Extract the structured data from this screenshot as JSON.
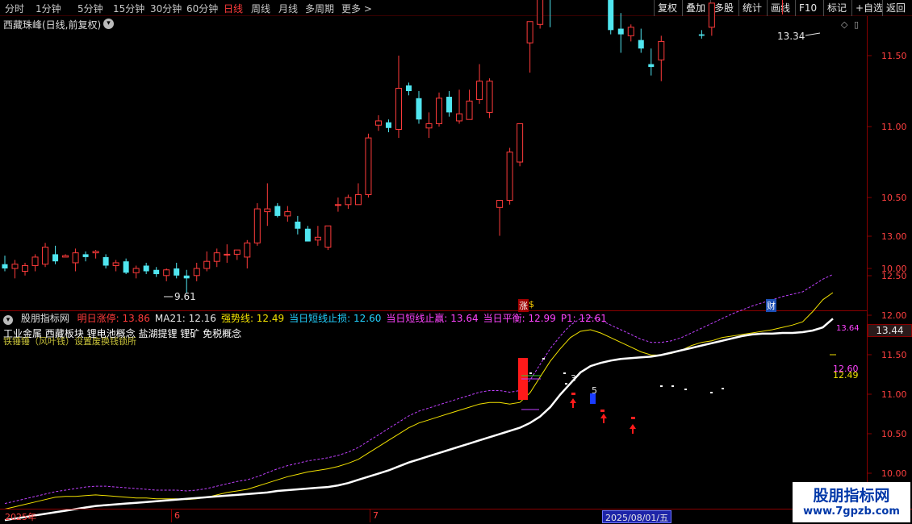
{
  "toolbar": {
    "periods": [
      "分时",
      "1分钟",
      "5分钟",
      "15分钟",
      "30分钟",
      "60分钟",
      "日线",
      "周线",
      "月线",
      "多周期",
      "更多 >"
    ],
    "active_period": "日线",
    "buttons": [
      "复权",
      "叠加",
      "多股",
      "统计",
      "画线",
      "F10",
      "标记",
      "+自选",
      "返回"
    ]
  },
  "main_chart": {
    "title": "西藏珠峰(日线,前复权)",
    "high_label": "13.34",
    "low_label": "9.61",
    "y_ticks": [
      "13.00",
      "12.50",
      "12.00",
      "11.50",
      "11.00",
      "10.50",
      "10.00"
    ],
    "markers": [
      "涨",
      "$",
      "财"
    ],
    "candles": [
      [
        10.03,
        10.09,
        9.98,
        10.0
      ],
      [
        10.0,
        10.06,
        9.93,
        10.03
      ],
      [
        9.98,
        10.04,
        9.95,
        10.02
      ],
      [
        10.02,
        10.1,
        9.98,
        10.08
      ],
      [
        10.03,
        10.18,
        10.01,
        10.15
      ],
      [
        10.1,
        10.16,
        10.03,
        10.05
      ],
      [
        10.08,
        10.1,
        10.08,
        10.09
      ],
      [
        10.04,
        10.14,
        9.98,
        10.11
      ],
      [
        10.1,
        10.12,
        10.05,
        10.08
      ],
      [
        10.11,
        10.13,
        10.07,
        10.12
      ],
      [
        10.08,
        10.1,
        10.0,
        10.02
      ],
      [
        10.02,
        10.06,
        9.98,
        10.04
      ],
      [
        10.05,
        10.07,
        9.96,
        9.97
      ],
      [
        9.97,
        10.02,
        9.93,
        10.0
      ],
      [
        10.02,
        10.04,
        9.96,
        9.98
      ],
      [
        9.99,
        10.01,
        9.94,
        9.96
      ],
      [
        9.95,
        10.0,
        9.91,
        9.99
      ],
      [
        10.0,
        10.04,
        9.93,
        9.95
      ],
      [
        9.95,
        9.99,
        9.83,
        9.93
      ],
      [
        9.95,
        10.04,
        9.91,
        10.0
      ],
      [
        10.0,
        10.12,
        9.98,
        10.05
      ],
      [
        10.05,
        10.14,
        10.01,
        10.11
      ],
      [
        10.1,
        10.17,
        10.04,
        10.1
      ],
      [
        10.1,
        10.13,
        10.06,
        10.13
      ],
      [
        10.08,
        10.2,
        10.0,
        10.18
      ],
      [
        10.18,
        10.46,
        10.16,
        10.42
      ],
      [
        10.4,
        10.6,
        10.3,
        10.42
      ],
      [
        10.44,
        10.46,
        10.36,
        10.37
      ],
      [
        10.37,
        10.44,
        10.33,
        10.4
      ],
      [
        10.33,
        10.37,
        10.24,
        10.28
      ],
      [
        10.28,
        10.3,
        10.2,
        10.19
      ],
      [
        10.2,
        10.3,
        10.16,
        10.22
      ],
      [
        10.15,
        10.3,
        10.13,
        10.3
      ],
      [
        10.45,
        10.5,
        10.4,
        10.45
      ],
      [
        10.45,
        10.52,
        10.42,
        10.5
      ],
      [
        10.45,
        10.6,
        10.45,
        10.52
      ],
      [
        10.52,
        10.95,
        10.5,
        10.92
      ],
      [
        11.01,
        11.08,
        10.97,
        11.04
      ],
      [
        11.03,
        11.05,
        10.96,
        10.99
      ],
      [
        10.98,
        11.5,
        10.92,
        11.27
      ],
      [
        11.29,
        11.31,
        11.22,
        11.25
      ],
      [
        11.2,
        11.25,
        11.02,
        11.05
      ],
      [
        10.99,
        11.1,
        10.92,
        11.02
      ],
      [
        11.02,
        11.24,
        11.0,
        11.2
      ],
      [
        11.21,
        11.25,
        11.07,
        11.1
      ],
      [
        11.04,
        11.26,
        11.02,
        11.09
      ],
      [
        11.05,
        11.26,
        11.05,
        11.18
      ],
      [
        11.19,
        11.44,
        11.16,
        11.32
      ],
      [
        11.1,
        11.34,
        11.06,
        11.32
      ],
      [
        10.43,
        10.47,
        10.23,
        10.48
      ],
      [
        10.48,
        10.85,
        10.45,
        10.82
      ],
      [
        10.75,
        11.02,
        10.72,
        11.02
      ],
      [
        11.59,
        11.7,
        11.38,
        11.74
      ],
      [
        11.72,
        13.0,
        11.69,
        12.95
      ],
      [
        12.4,
        12.85,
        11.7,
        12.02
      ],
      [
        11.9,
        12.96,
        11.93,
        12.75
      ],
      [
        12.27,
        13.04,
        12.1,
        12.67
      ],
      [
        12.29,
        12.31,
        12.26,
        12.31
      ],
      [
        12.14,
        12.27,
        12.0,
        12.24
      ],
      [
        12.25,
        12.42,
        12.11,
        12.21
      ],
      [
        12.02,
        12.27,
        11.65,
        11.68
      ],
      [
        11.69,
        11.8,
        11.52,
        11.65
      ],
      [
        11.64,
        11.72,
        11.6,
        11.7
      ],
      [
        11.61,
        11.69,
        11.52,
        11.55
      ],
      [
        11.44,
        11.55,
        11.36,
        11.42
      ],
      [
        11.47,
        11.64,
        11.32,
        11.6
      ],
      [
        12.0,
        12.3,
        11.98,
        12.23
      ],
      [
        12.05,
        12.15,
        11.95,
        12.04
      ],
      [
        12.01,
        12.04,
        11.93,
        12.06
      ],
      [
        11.65,
        11.68,
        11.62,
        11.64
      ],
      [
        11.7,
        11.75,
        11.64,
        11.87
      ],
      [
        12.0,
        12.07,
        11.96,
        12.04
      ],
      [
        12.1,
        12.37,
        12.09,
        12.19
      ],
      [
        12.34,
        12.45,
        12.19,
        12.21
      ],
      [
        12.2,
        12.35,
        12.15,
        12.26
      ],
      [
        12.49,
        12.55,
        12.44,
        12.45
      ],
      [
        12.25,
        12.65,
        12.02,
        12.14
      ],
      [
        11.97,
        12.17,
        11.79,
        12.19
      ],
      [
        12.41,
        12.5,
        12.37,
        12.42
      ],
      [
        12.42,
        12.71,
        12.36,
        12.74
      ],
      [
        13.03,
        13.3,
        12.97,
        13.14
      ],
      [
        13.06,
        13.34,
        12.97,
        13.02
      ],
      [
        12.62,
        13.0,
        12.55,
        12.98
      ]
    ]
  },
  "indicator": {
    "name": "股朋指标网",
    "items": [
      {
        "label": "明日涨停",
        "value": "13.86",
        "color": "#ff3b3b"
      },
      {
        "label": "MA21",
        "value": "12.16",
        "color": "#e6e6e6"
      },
      {
        "label": "强势线",
        "value": "12.49",
        "color": "#f0e000"
      },
      {
        "label": "当日短线止损",
        "value": "12.60",
        "color": "#22d1ff"
      },
      {
        "label": "当日短线止赢",
        "value": "13.64",
        "color": "#ff44ff"
      },
      {
        "label": "当日平衡",
        "value": "12.99",
        "color": "#ff44ff"
      },
      {
        "label": "P1",
        "value": "12.61",
        "color": "#ff44ff"
      }
    ],
    "concepts": "工业金属 西藏板块 锂电池概念 盐湖提锂 锂矿 免税概念",
    "sub_note": "铁锤锤（风叶钱）设置废换钱锁所",
    "y_ticks": [
      "13.00",
      "12.50",
      "12.00",
      "11.50",
      "11.00",
      "10.50",
      "10.00"
    ],
    "top_value": "13.44",
    "top_line_label": "13.64",
    "right_labels": [
      "12.60",
      "12.49"
    ],
    "mark_labels": [
      "3",
      "5"
    ],
    "lines": {
      "white": [
        9.61,
        9.63,
        9.65,
        9.67,
        9.69,
        9.71,
        9.73,
        9.75,
        9.77,
        9.79,
        9.8,
        9.81,
        9.82,
        9.83,
        9.84,
        9.85,
        9.86,
        9.87,
        9.88,
        9.89,
        9.9,
        9.91,
        9.92,
        9.93,
        9.94,
        9.95,
        9.96,
        9.98,
        9.99,
        10.0,
        10.01,
        10.02,
        10.03,
        10.05,
        10.08,
        10.12,
        10.16,
        10.2,
        10.24,
        10.29,
        10.34,
        10.38,
        10.42,
        10.46,
        10.5,
        10.54,
        10.58,
        10.62,
        10.66,
        10.7,
        10.74,
        10.78,
        10.84,
        10.92,
        11.04,
        11.2,
        11.34,
        11.48,
        11.56,
        11.6,
        11.63,
        11.65,
        11.66,
        11.67,
        11.68,
        11.7,
        11.73,
        11.76,
        11.79,
        11.82,
        11.85,
        11.88,
        11.91,
        11.94,
        11.96,
        11.97,
        11.97,
        11.98,
        11.98,
        11.99,
        12.01,
        12.05,
        12.16
      ],
      "yellow": [
        9.75,
        9.78,
        9.81,
        9.84,
        9.87,
        9.9,
        9.91,
        9.91,
        9.92,
        9.93,
        9.92,
        9.91,
        9.9,
        9.89,
        9.89,
        9.88,
        9.88,
        9.88,
        9.87,
        9.88,
        9.9,
        9.93,
        9.96,
        9.98,
        10.0,
        10.04,
        10.08,
        10.12,
        10.16,
        10.19,
        10.22,
        10.24,
        10.26,
        10.29,
        10.33,
        10.38,
        10.46,
        10.54,
        10.62,
        10.7,
        10.78,
        10.84,
        10.88,
        10.92,
        10.96,
        11.0,
        11.04,
        11.08,
        11.1,
        11.1,
        11.08,
        11.1,
        11.22,
        11.42,
        11.62,
        11.78,
        11.92,
        12.0,
        12.02,
        11.98,
        11.92,
        11.86,
        11.8,
        11.74,
        11.7,
        11.7,
        11.72,
        11.76,
        11.82,
        11.86,
        11.88,
        11.92,
        11.94,
        11.96,
        11.98,
        12.0,
        12.02,
        12.05,
        12.08,
        12.12,
        12.25,
        12.4,
        12.49
      ],
      "magenta": [
        9.82,
        9.85,
        9.88,
        9.91,
        9.94,
        9.97,
        9.99,
        10.01,
        10.03,
        10.04,
        10.04,
        10.03,
        10.02,
        10.01,
        10.0,
        9.99,
        9.99,
        9.99,
        9.98,
        9.99,
        10.01,
        10.04,
        10.07,
        10.1,
        10.12,
        10.16,
        10.21,
        10.26,
        10.3,
        10.33,
        10.36,
        10.38,
        10.4,
        10.43,
        10.47,
        10.53,
        10.61,
        10.69,
        10.77,
        10.85,
        10.93,
        10.99,
        11.03,
        11.07,
        11.11,
        11.15,
        11.19,
        11.23,
        11.25,
        11.25,
        11.23,
        11.25,
        11.38,
        11.58,
        11.78,
        11.94,
        12.08,
        12.16,
        12.18,
        12.14,
        12.08,
        12.02,
        11.96,
        11.9,
        11.86,
        11.86,
        11.88,
        11.92,
        11.98,
        12.04,
        12.1,
        12.16,
        12.22,
        12.27,
        12.32,
        12.36,
        12.4,
        12.44,
        12.47,
        12.5,
        12.58,
        12.66,
        12.72
      ]
    }
  },
  "date_axis": {
    "labels": [
      "2025年",
      "6",
      "7"
    ],
    "cursor_date": "2025/08/01/五"
  },
  "watermark": {
    "title": "股朋指标网",
    "url": "www.7gpzb.com"
  },
  "colors": {
    "up": "#ff3b3b",
    "down": "#50e6f0",
    "grid_red": "#8a0000"
  }
}
